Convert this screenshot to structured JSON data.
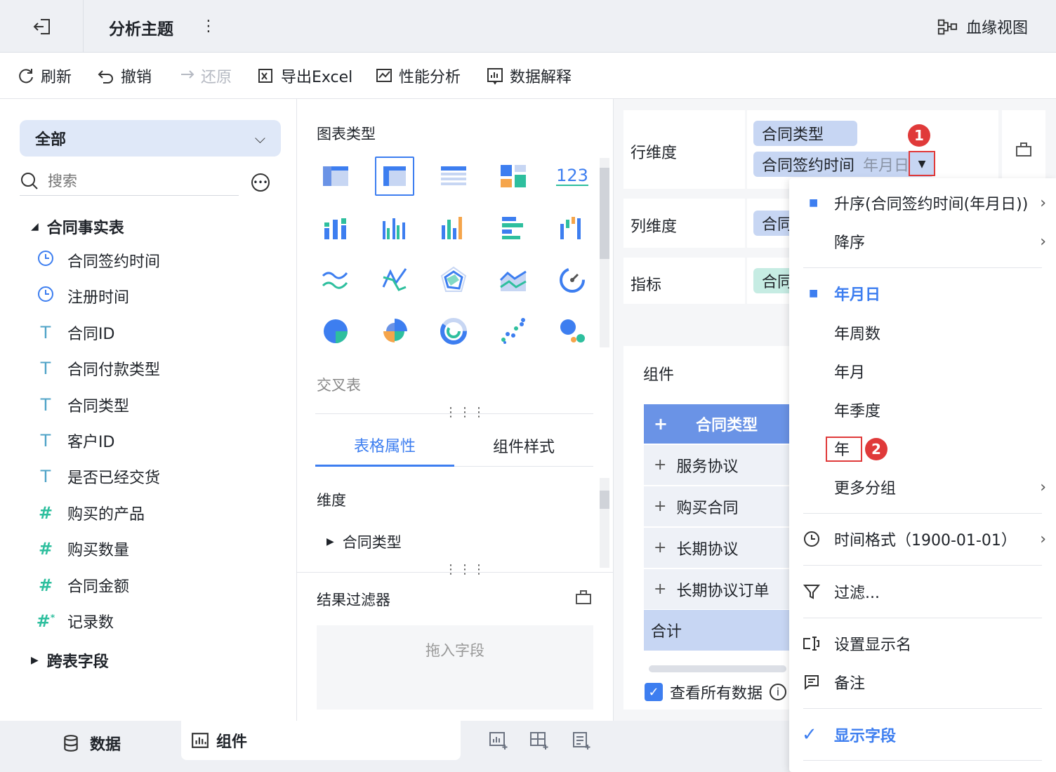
{
  "header": {
    "title": "分析主题",
    "lineage_label": "血缘视图"
  },
  "toolbar": {
    "refresh": "刷新",
    "undo": "撤销",
    "redo": "还原",
    "export": "导出Excel",
    "perf": "性能分析",
    "explain": "数据解释"
  },
  "left": {
    "scope": "全部",
    "search_placeholder": "搜索",
    "table_name": "合同事实表",
    "fields": [
      {
        "icon": "clock-icon",
        "label": "合同签约时间"
      },
      {
        "icon": "clock-icon",
        "label": "注册时间"
      },
      {
        "icon": "text-type-icon",
        "label": "合同ID"
      },
      {
        "icon": "text-type-icon",
        "label": "合同付款类型"
      },
      {
        "icon": "text-type-icon",
        "label": "合同类型"
      },
      {
        "icon": "text-type-icon",
        "label": "客户ID"
      },
      {
        "icon": "text-type-icon",
        "label": "是否已经交货"
      },
      {
        "icon": "number-type-icon",
        "label": "购买的产品"
      },
      {
        "icon": "number-type-icon",
        "label": "购买数量"
      },
      {
        "icon": "number-type-icon",
        "label": "合同金额"
      },
      {
        "icon": "calc-number-icon",
        "label": "记录数"
      }
    ],
    "cross_table": "跨表字段"
  },
  "middle": {
    "chart_type_title": "图表类型",
    "chart_123": "123",
    "selected_chart_name": "交叉表",
    "tabs": [
      "表格属性",
      "组件样式"
    ],
    "dimension_title": "维度",
    "dimension_item": "合同类型",
    "result_filter": "结果过滤器",
    "drop_hint": "拖入字段"
  },
  "right": {
    "row_dim_label": "行维度",
    "row_pill_1": "合同类型",
    "row_pill_2": "合同签约时间",
    "row_pill_2_suffix": "年月日",
    "col_dim_label": "列维度",
    "col_pill": "合同",
    "measure_label": "指标",
    "measure_pill": "合同",
    "component_title": "组件",
    "table_header": "合同类型",
    "table_rows": [
      "服务协议",
      "购买合同",
      "长期协议",
      "长期协议订单"
    ],
    "table_total": "合计",
    "view_all": "查看所有数据"
  },
  "menu": {
    "asc": "升序(合同签约时间(年月日))",
    "desc": "降序",
    "ymd": "年月日",
    "yw": "年周数",
    "ym": "年月",
    "yq": "年季度",
    "y": "年",
    "more_group": "更多分组",
    "time_format": "时间格式（1900-01-01）",
    "filter": "过滤...",
    "display_name": "设置显示名",
    "note": "备注",
    "show_field": "显示字段"
  },
  "badges": {
    "one": "1",
    "two": "2"
  },
  "bottom": {
    "data_tab": "数据",
    "component_tab": "组件"
  },
  "colors": {
    "accent": "#3d7ef0",
    "pill_blue": "#c7d6f3",
    "pill_green": "#c6ece3",
    "header_blue": "#6a93e6",
    "red": "#e03a3a"
  }
}
